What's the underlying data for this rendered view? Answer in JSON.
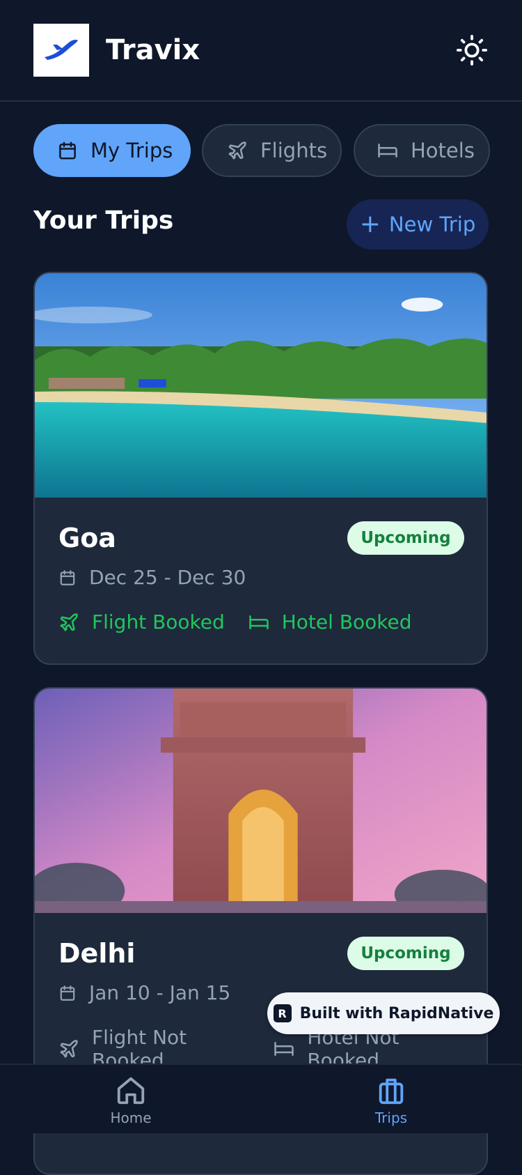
{
  "app": {
    "name": "Travix",
    "logo_icon": "plane-logo-icon",
    "theme_icon": "sun-icon"
  },
  "tabs": [
    {
      "label": "My Trips",
      "icon": "calendar-icon",
      "active": true
    },
    {
      "label": "Flights",
      "icon": "plane-icon",
      "active": false
    },
    {
      "label": "Hotels",
      "icon": "bed-icon",
      "active": false
    }
  ],
  "section": {
    "title": "Your Trips",
    "new_trip_label": "New Trip"
  },
  "trips": [
    {
      "name": "Goa",
      "status": "Upcoming",
      "dates": "Dec 25 - Dec 30",
      "flight": "Flight Booked",
      "hotel": "Hotel Booked"
    },
    {
      "name": "Delhi",
      "status": "Upcoming",
      "dates": "Jan 10 - Jan 15",
      "flight": "Flight Not Booked",
      "hotel": "Hotel Not Booked"
    }
  ],
  "rapid_badge": {
    "label": "Built with RapidNative"
  },
  "bottom_nav": [
    {
      "label": "Home",
      "icon": "home-icon",
      "active": false
    },
    {
      "label": "Trips",
      "icon": "briefcase-icon",
      "active": true
    }
  ],
  "colors": {
    "background": "#0f172a",
    "accent": "#60a5fa",
    "success": "#22c55e",
    "card": "#1e293b"
  }
}
